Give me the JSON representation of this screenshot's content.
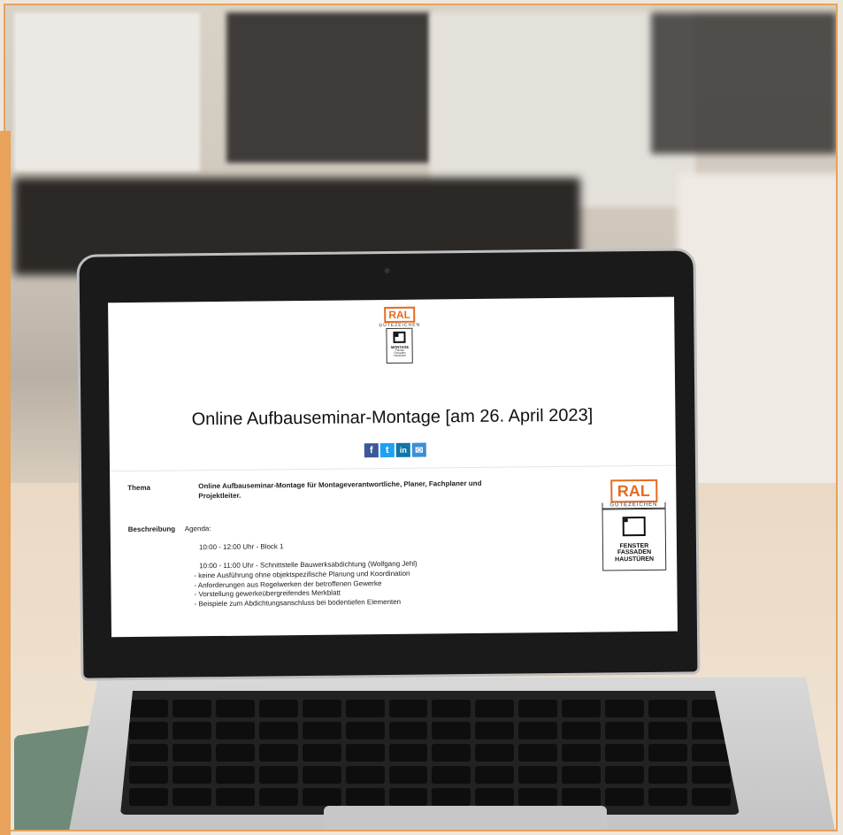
{
  "screen": {
    "logo_top": {
      "ral": "RAL",
      "guetezeichen": "GÜTEZEICHEN",
      "emblem_lines": [
        "MONTAGE",
        "Fenster",
        "Fassaden",
        "Haustüren"
      ]
    },
    "title": "Online Aufbauseminar-Montage [am 26. April 2023]",
    "share": {
      "facebook": "f",
      "twitter": "t",
      "linkedin": "in",
      "email": "✉",
      "colors": {
        "facebook": "#3b5998",
        "twitter": "#1da1f2",
        "linkedin": "#0e76a8",
        "email": "#3a8fd6"
      }
    },
    "thema": {
      "label": "Thema",
      "text": "Online Aufbauseminar-Montage für Montageverantwortliche, Planer, Fachplaner und Projektleiter."
    },
    "beschreibung": {
      "label": "Beschreibung",
      "intro": "Agenda:",
      "block": "10:00 - 12:00 Uhr - Block 1",
      "lines": [
        "10:00 - 11:00 Uhr - Schnittstelle Bauwerksabdichtung (Wolfgang Jehl)",
        "- keine Ausführung ohne objektspezifische Planung und Koordination",
        "- Anforderungen aus Regelwerken der betroffenen Gewerke",
        "- Vorstellung gewerkeübergreifendes Merkblatt",
        "- Beispiele zum Abdichtungsanschluss bei bodentiefen Elementen"
      ]
    },
    "logo_side": {
      "ral": "RAL",
      "guetezeichen": "GÜTEZEICHEN",
      "emblem_lines": [
        "FENSTER",
        "FASSADEN",
        "HAUSTÜREN"
      ]
    },
    "accent_color": "#e56b23"
  }
}
